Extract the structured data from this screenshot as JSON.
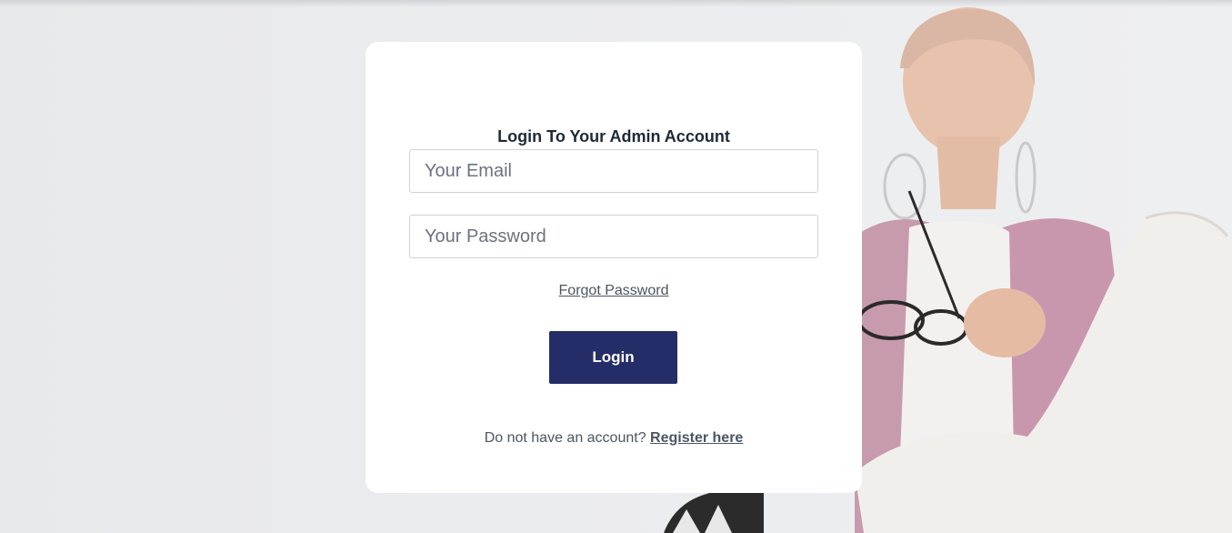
{
  "login": {
    "title": "Login To Your Admin Account",
    "email_placeholder": "Your Email",
    "password_placeholder": "Your Password",
    "forgot_password_label": "Forgot Password",
    "login_button_label": "Login",
    "register_prompt": "Do not have an account? ",
    "register_link_label": "Register here"
  },
  "colors": {
    "page_background": "#ebecef",
    "card_background": "#ffffff",
    "button_background": "#242d67",
    "button_text": "#ffffff",
    "title_text": "#1f2937",
    "muted_text": "#4b5563"
  }
}
